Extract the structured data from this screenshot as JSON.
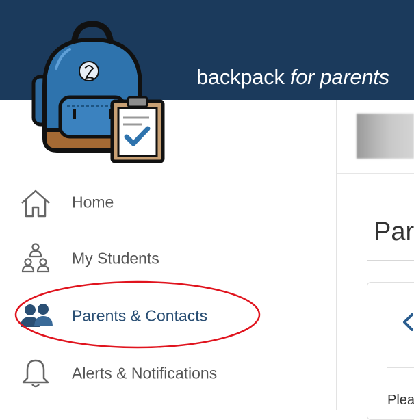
{
  "header": {
    "brand_main": "backpack ",
    "brand_em": "for parents",
    "bar_color": "#1b3a5c"
  },
  "nav": {
    "items": [
      {
        "label": "Home",
        "icon": "home-icon"
      },
      {
        "label": "My Students",
        "icon": "students-icon"
      },
      {
        "label": "Parents & Contacts",
        "icon": "contacts-icon",
        "active": true
      },
      {
        "label": "Alerts & Notifications",
        "icon": "bell-icon"
      }
    ],
    "highlight_color": "#e0141e"
  },
  "main": {
    "title": "Parents & Contacts",
    "card_text": "Please"
  }
}
